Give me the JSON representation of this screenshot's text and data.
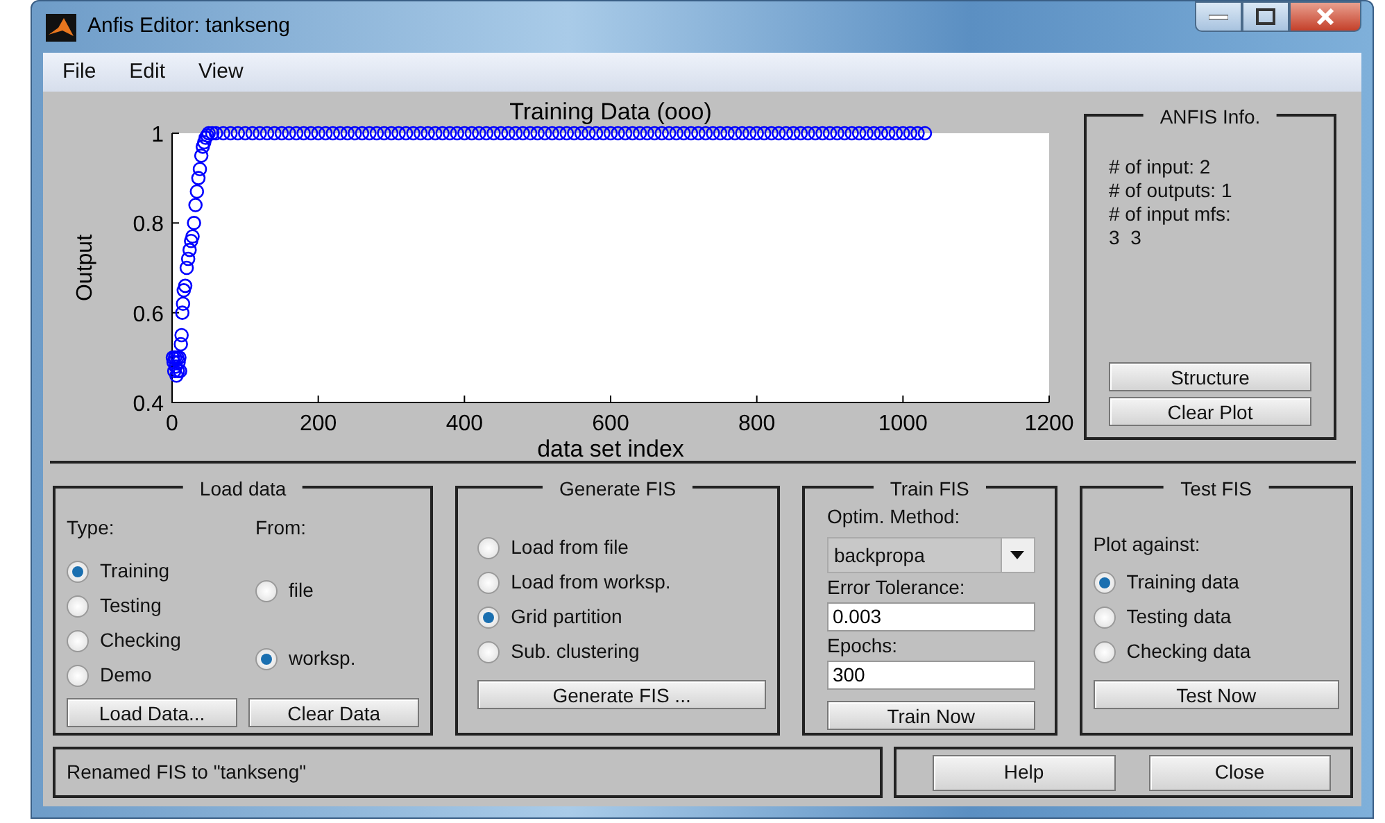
{
  "window": {
    "title": "Anfis Editor: tankseng"
  },
  "menu": [
    "File",
    "Edit",
    "View"
  ],
  "plot": {
    "chart_data": {
      "type": "scatter",
      "title": "Training Data (ooo)",
      "xlabel": "data set index",
      "ylabel": "Output",
      "xlim": [
        0,
        1200
      ],
      "ylim": [
        0.4,
        1
      ],
      "xticks": [
        0,
        200,
        400,
        600,
        800,
        1000,
        1200
      ],
      "yticks": [
        0.4,
        0.6,
        0.8,
        1
      ],
      "x": [
        1,
        2,
        3,
        4,
        5,
        6,
        7,
        8,
        9,
        10,
        11,
        12,
        13,
        14,
        15,
        16,
        18,
        20,
        22,
        24,
        26,
        28,
        30,
        32,
        34,
        36,
        38,
        40,
        42,
        44,
        46,
        48,
        50,
        55,
        60,
        70,
        80,
        90,
        100,
        110,
        120,
        130,
        140,
        150,
        160,
        170,
        180,
        190,
        200,
        210,
        220,
        230,
        240,
        250,
        260,
        270,
        280,
        290,
        300,
        310,
        320,
        330,
        340,
        350,
        360,
        370,
        380,
        390,
        400,
        410,
        420,
        430,
        440,
        450,
        460,
        470,
        480,
        490,
        500,
        510,
        520,
        530,
        540,
        550,
        560,
        570,
        580,
        590,
        600,
        610,
        620,
        630,
        640,
        650,
        660,
        670,
        680,
        690,
        700,
        710,
        720,
        730,
        740,
        750,
        760,
        770,
        780,
        790,
        800,
        810,
        820,
        830,
        840,
        850,
        860,
        870,
        880,
        890,
        900,
        910,
        920,
        930,
        940,
        950,
        960,
        970,
        980,
        990,
        1000,
        1010,
        1020,
        1030
      ],
      "series": [
        {
          "color": "#0000ff",
          "values": [
            0.5,
            0.49,
            0.47,
            0.5,
            0.48,
            0.46,
            0.5,
            0.47,
            0.49,
            0.5,
            0.47,
            0.53,
            0.55,
            0.6,
            0.62,
            0.65,
            0.66,
            0.7,
            0.72,
            0.74,
            0.76,
            0.77,
            0.8,
            0.84,
            0.87,
            0.9,
            0.92,
            0.95,
            0.97,
            0.98,
            0.99,
            0.995,
            1,
            1,
            1,
            1,
            1,
            1,
            1,
            1,
            1,
            1,
            1,
            1,
            1,
            1,
            1,
            1,
            1,
            1,
            1,
            1,
            1,
            1,
            1,
            1,
            1,
            1,
            1,
            1,
            1,
            1,
            1,
            1,
            1,
            1,
            1,
            1,
            1,
            1,
            1,
            1,
            1,
            1,
            1,
            1,
            1,
            1,
            1,
            1,
            1,
            1,
            1,
            1,
            1,
            1,
            1,
            1,
            1,
            1,
            1,
            1,
            1,
            1,
            1,
            1,
            1,
            1,
            1,
            1,
            1,
            1,
            1,
            1,
            1,
            1,
            1,
            1,
            1,
            1,
            1,
            1,
            1,
            1,
            1,
            1,
            1,
            1,
            1,
            1,
            1,
            1,
            1,
            1,
            1,
            1,
            1,
            1,
            1,
            1,
            1,
            1
          ]
        }
      ]
    }
  },
  "anfis_info": {
    "title": "ANFIS Info.",
    "lines": [
      "# of input: 2",
      "# of outputs: 1",
      "# of input mfs:",
      "3  3"
    ],
    "buttons": [
      "Structure",
      "Clear Plot"
    ]
  },
  "load_data": {
    "title": "Load data",
    "type_label": "Type:",
    "from_label": "From:",
    "types": [
      {
        "label": "Training",
        "selected": true
      },
      {
        "label": "Testing",
        "selected": false
      },
      {
        "label": "Checking",
        "selected": false
      },
      {
        "label": "Demo",
        "selected": false
      }
    ],
    "sources": [
      {
        "label": "file",
        "selected": false
      },
      {
        "label": "worksp.",
        "selected": true
      }
    ],
    "buttons": [
      "Load Data...",
      "Clear Data"
    ]
  },
  "generate_fis": {
    "title": "Generate FIS",
    "options": [
      {
        "label": "Load from file",
        "selected": false
      },
      {
        "label": "Load from worksp.",
        "selected": false
      },
      {
        "label": "Grid partition",
        "selected": true
      },
      {
        "label": "Sub. clustering",
        "selected": false
      }
    ],
    "button": "Generate FIS ..."
  },
  "train_fis": {
    "title": "Train FIS",
    "method_label": "Optim. Method:",
    "method": "backpropa",
    "tolerance_label": "Error Tolerance:",
    "tolerance": "0.003",
    "epochs_label": "Epochs:",
    "epochs": "300",
    "button": "Train Now"
  },
  "test_fis": {
    "title": "Test FIS",
    "plot_label": "Plot against:",
    "options": [
      {
        "label": "Training data",
        "selected": true
      },
      {
        "label": "Testing data",
        "selected": false
      },
      {
        "label": "Checking data",
        "selected": false
      }
    ],
    "button": "Test Now"
  },
  "status_bar": "Renamed FIS to \"tankseng\"",
  "buttons": [
    "Help",
    "Close"
  ]
}
